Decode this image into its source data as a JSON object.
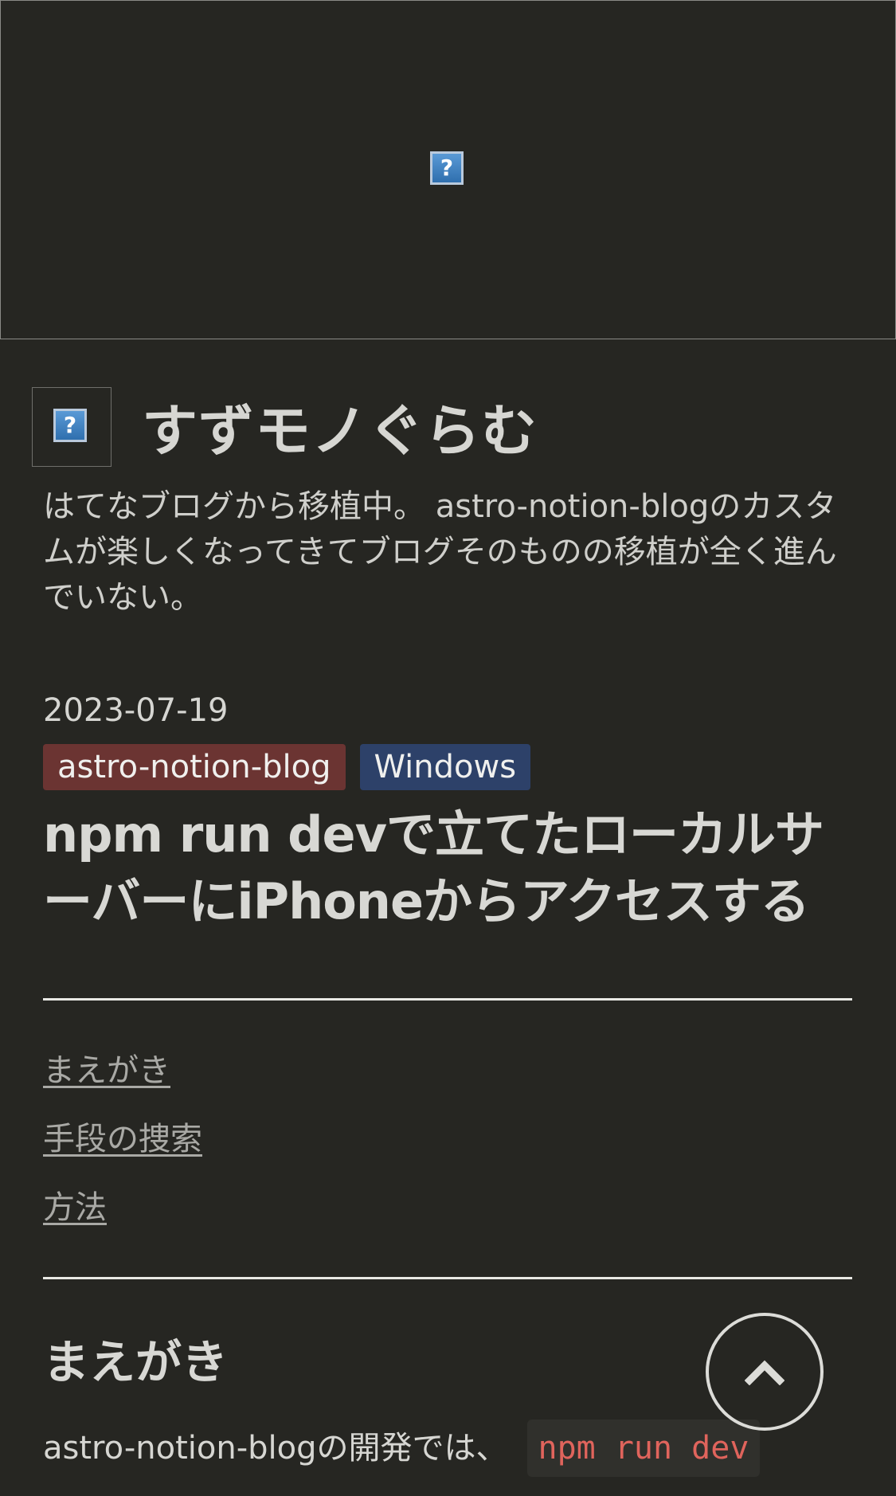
{
  "cover": {
    "image_icon": "broken-image-icon",
    "glyph": "?"
  },
  "header": {
    "logo_icon": "broken-image-icon",
    "logo_glyph": "?",
    "site_title": "すずモノぐらむ",
    "site_description": "はてなブログから移植中。 astro-notion-blogのカスタムが楽しくなってきてブログそのものの移植が全く進んでいない。"
  },
  "post": {
    "date": "2023-07-19",
    "tags": [
      {
        "label": "astro-notion-blog",
        "color": "#6b3432"
      },
      {
        "label": "Windows",
        "color": "#2d4169"
      }
    ],
    "title": "npm run devで立てたローカルサーバーにiPhoneからアクセスする"
  },
  "toc": {
    "items": [
      {
        "label": "まえがき"
      },
      {
        "label": "手段の捜索"
      },
      {
        "label": "方法"
      }
    ]
  },
  "content": {
    "section_heading": "まえがき",
    "paragraph_text": "astro-notion-blogの開発では、",
    "inline_code": "npm run dev"
  },
  "scroll_top": {
    "icon": "chevron-up-icon"
  },
  "colors": {
    "background": "#262622",
    "text": "#d8d8d4",
    "link": "#a9a9a5",
    "code_text": "#e0645c",
    "code_bg": "#30302c"
  }
}
